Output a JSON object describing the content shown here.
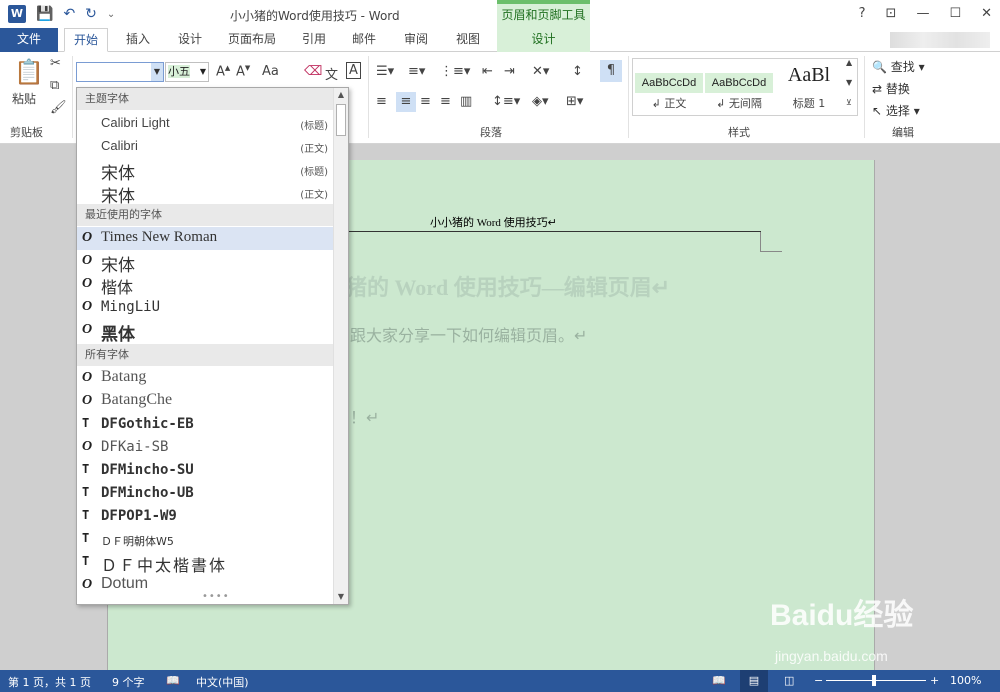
{
  "window": {
    "title": "小小猪的Word使用技巧 - Word",
    "context_tab_group": "页眉和页脚工具"
  },
  "tabs": [
    "开始",
    "插入",
    "设计",
    "页面布局",
    "引用",
    "邮件",
    "审阅",
    "视图",
    "设计"
  ],
  "file_tab": "文件",
  "ribbon": {
    "clipboard": {
      "paste": "粘贴",
      "label": "剪贴板"
    },
    "font": {
      "name_value": "",
      "size_value": "小五",
      "case_button": "Aa"
    },
    "paragraph_label": "段落",
    "styles": {
      "label": "样式",
      "items": [
        {
          "sample": "AaBbCcDd",
          "name": "↲ 正文"
        },
        {
          "sample": "AaBbCcDd",
          "name": "↲ 无间隔"
        },
        {
          "sample": "AaBl",
          "name": "标题 1"
        }
      ]
    },
    "editing": {
      "find": "查找",
      "replace": "替换",
      "select": "选择",
      "label": "编辑"
    }
  },
  "font_dropdown": {
    "sections": [
      {
        "title": "主题字体",
        "items": [
          {
            "name": "Calibri Light",
            "tag": "(标题)"
          },
          {
            "name": "Calibri",
            "tag": "(正文)"
          },
          {
            "name": "宋体",
            "tag": "(标题)"
          },
          {
            "name": "宋体",
            "tag": "(正文)"
          }
        ]
      },
      {
        "title": "最近使用的字体",
        "items": [
          {
            "name": "Times New Roman",
            "icon": "O",
            "selected": true
          },
          {
            "name": "宋体",
            "icon": "O"
          },
          {
            "name": "楷体",
            "icon": "O"
          },
          {
            "name": "MingLiU",
            "icon": "O"
          },
          {
            "name": "黑体",
            "icon": "O"
          }
        ]
      },
      {
        "title": "所有字体",
        "items": [
          {
            "name": "Batang",
            "icon": "O"
          },
          {
            "name": "BatangChe",
            "icon": "O"
          },
          {
            "name": "DFGothic-EB",
            "icon": "T"
          },
          {
            "name": "DFKai-SB",
            "icon": "O"
          },
          {
            "name": "DFMincho-SU",
            "icon": "T"
          },
          {
            "name": "DFMincho-UB",
            "icon": "T"
          },
          {
            "name": "DFPOP1-W9",
            "icon": "T"
          },
          {
            "name": "ＤＦ明朝体W5",
            "icon": "T"
          },
          {
            "name": "ＤＦ中太楷書体",
            "icon": "T"
          },
          {
            "name": "Dotum",
            "icon": "O"
          }
        ]
      }
    ]
  },
  "document": {
    "header_text": "小小猪的 Word 使用技巧↵",
    "title": "猪的 Word 使用技巧—编辑页眉↵",
    "line1": "跟大家分享一下如何编辑页眉。↵",
    "line2": "！↵"
  },
  "statusbar": {
    "page": "第 1 页，共 1 页",
    "words": "9 个字",
    "language": "中文(中国)",
    "zoom": "100%"
  },
  "watermark": {
    "brand": "Baidu经验",
    "url": "jingyan.baidu.com"
  },
  "colors": {
    "accent": "#2b579a",
    "context": "#d8f0d8",
    "page": "#cce8cf"
  }
}
